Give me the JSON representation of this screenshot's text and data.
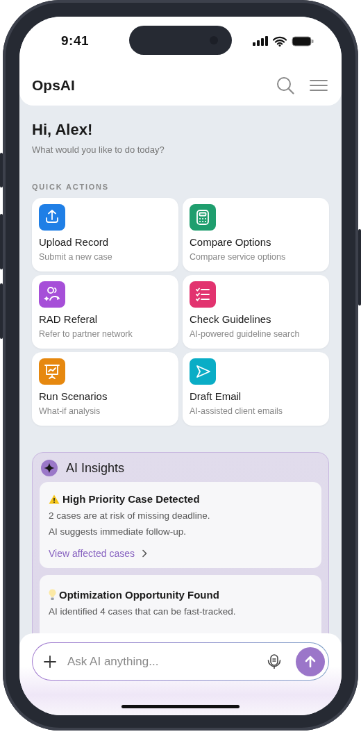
{
  "status_bar": {
    "time": "9:41"
  },
  "header": {
    "title": "OpsAI"
  },
  "greeting": {
    "title": "Hi, Alex!",
    "subtitle": "What would you like to do today?"
  },
  "quick_actions": {
    "heading": "QUICK ACTIONS",
    "items": [
      {
        "kind": "upload",
        "title": "Upload Record",
        "subtitle": "Submit a new case",
        "color": "#1f7fe6"
      },
      {
        "kind": "calculator",
        "title": "Compare Options",
        "subtitle": "Compare service options",
        "color": "#1f9e6e"
      },
      {
        "kind": "people",
        "title": "RAD Referal",
        "subtitle": "Refer to partner network",
        "color": "#a64fd8"
      },
      {
        "kind": "checklist",
        "title": "Check Guidelines",
        "subtitle": "AI-powered guideline search",
        "color": "#e2336f"
      },
      {
        "kind": "presentation",
        "title": "Run Scenarios",
        "subtitle": "What-if analysis",
        "color": "#e6880f"
      },
      {
        "kind": "send",
        "title": "Draft Email",
        "subtitle": "AI-assisted client emails",
        "color": "#0aadc6"
      }
    ]
  },
  "insights": {
    "title": "AI Insights",
    "cards": [
      {
        "kind": "warning",
        "title": "High Priority Case Detected",
        "lines": [
          "2 cases are at risk of missing deadline.",
          "AI suggests immediate follow-up."
        ],
        "link": "View affected cases"
      },
      {
        "kind": "idea",
        "title": "Optimization Opportunity Found",
        "lines": [
          "AI identified 4 cases that can be fast-tracked."
        ]
      }
    ]
  },
  "composer": {
    "placeholder": "Ask AI anything..."
  }
}
